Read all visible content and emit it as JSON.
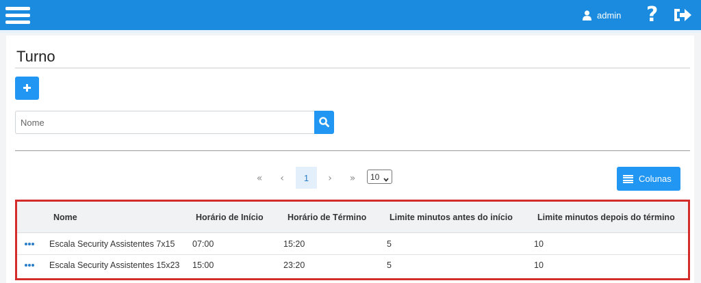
{
  "header": {
    "menu_icon": "hamburger-menu-icon",
    "user_icon": "user-icon",
    "user_name": "admin",
    "help_icon": "question-mark-icon",
    "help_glyph": "?",
    "logout_icon": "sign-out-icon",
    "color": "#1a8bde"
  },
  "page": {
    "title": "Turno",
    "add_icon": "plus-icon",
    "search_placeholder": "Nome",
    "search_value": "",
    "search_icon": "search-icon"
  },
  "pagination": {
    "first": "«",
    "prev": "‹",
    "current": "1",
    "next": "›",
    "last": "»",
    "page_size": "10",
    "page_size_caret": "▾"
  },
  "columns_button": {
    "label": "Colunas",
    "icon": "list-lines-icon"
  },
  "table": {
    "headers": [
      "Nome",
      "Horário de Início",
      "Horário de Término",
      "Limite minutos antes do início",
      "Limite minutos depois do término"
    ],
    "rows": [
      [
        "Escala Security Assistentes 7x15",
        "07:00",
        "15:20",
        "5",
        "10"
      ],
      [
        "Escala Security Assistentes 15x23",
        "15:00",
        "23:20",
        "5",
        "10"
      ]
    ],
    "row_action_icon": "ellipsis-icon"
  },
  "colors": {
    "primary": "#2196f3",
    "highlight_border": "#d42b2b"
  }
}
